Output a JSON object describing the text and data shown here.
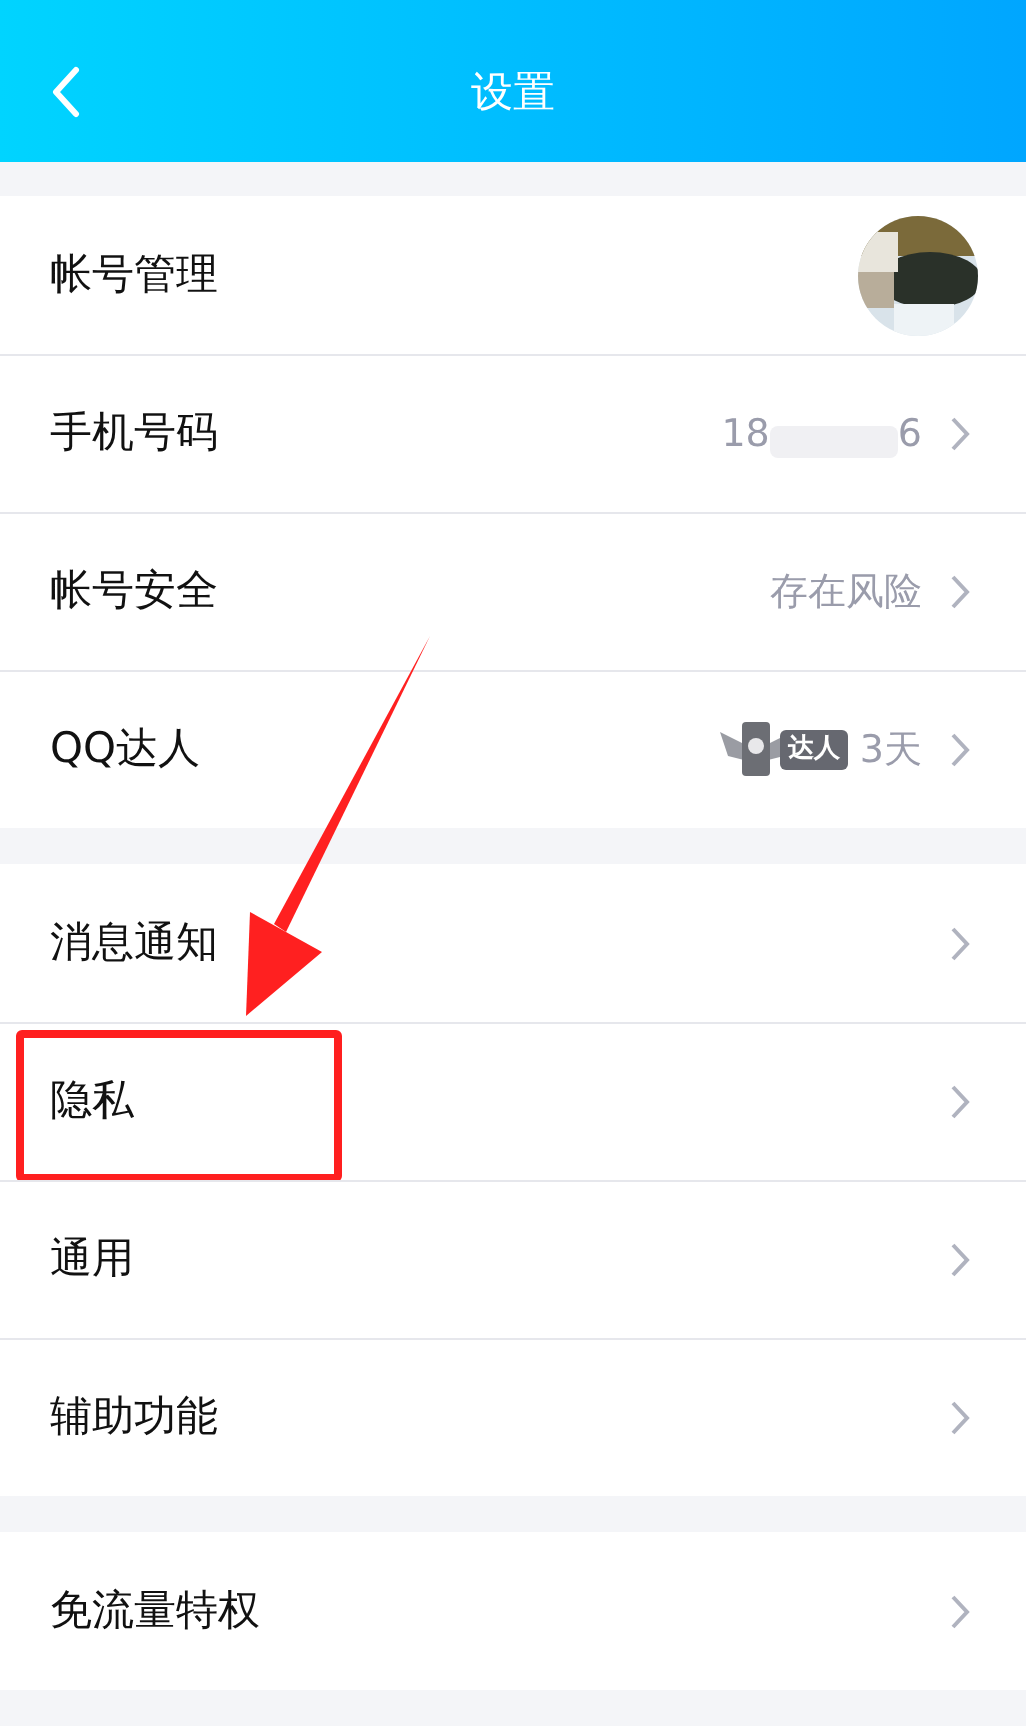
{
  "header": {
    "title": "设置"
  },
  "groups": [
    {
      "rows": [
        {
          "kind": "avatar",
          "label": "帐号管理",
          "highlighted": false
        },
        {
          "kind": "phone",
          "label": "手机号码",
          "value_start": "18",
          "value_end": "6",
          "highlighted": false
        },
        {
          "kind": "value",
          "label": "帐号安全",
          "value": "存在风险",
          "highlighted": false
        },
        {
          "kind": "badge",
          "label": "QQ达人",
          "badge": "达人",
          "value": "3天",
          "highlighted": false
        }
      ]
    },
    {
      "rows": [
        {
          "kind": "plain",
          "label": "消息通知",
          "highlighted": false
        },
        {
          "kind": "plain",
          "label": "隐私",
          "highlighted": true
        },
        {
          "kind": "plain",
          "label": "通用",
          "highlighted": false
        },
        {
          "kind": "plain",
          "label": "辅助功能",
          "highlighted": false
        }
      ]
    },
    {
      "rows": [
        {
          "kind": "plain",
          "label": "免流量特权",
          "highlighted": false
        }
      ]
    }
  ]
}
